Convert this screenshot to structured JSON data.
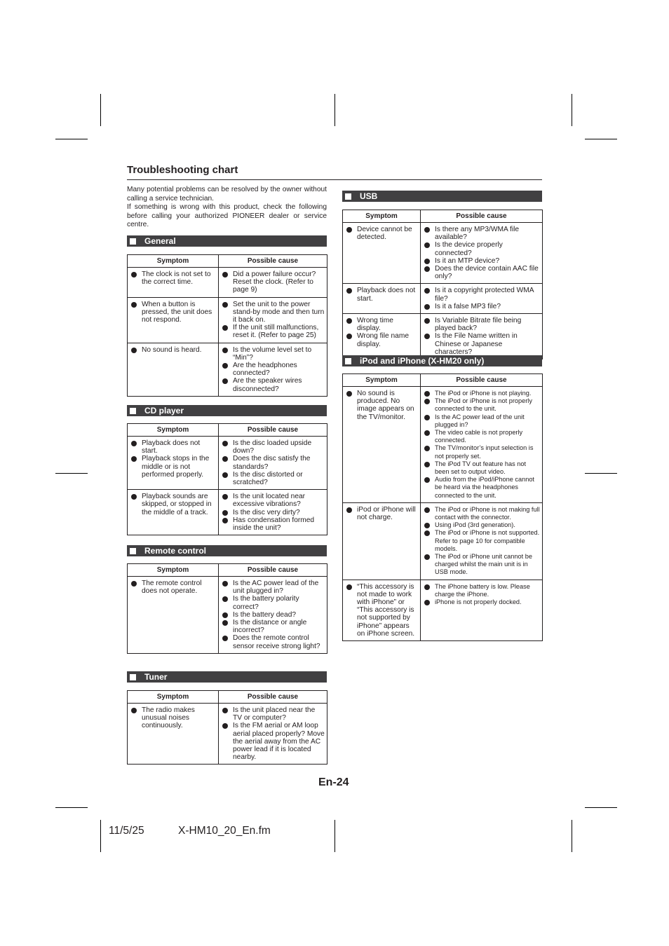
{
  "page": {
    "title": "Troubleshooting chart",
    "intro": [
      "Many potential problems can be resolved by the owner without calling a service technician.",
      "If something is wrong with this product, check the following before calling your authorized PIONEER dealer or service centre."
    ],
    "page_number": "En-24",
    "footer": {
      "date": "11/5/25",
      "filename": "X-HM10_20_En.fm"
    }
  },
  "columns": {
    "symptom": "Symptom",
    "cause": "Possible cause"
  },
  "sections": {
    "general": {
      "title": "General",
      "rows": [
        {
          "symptoms": [
            "The clock is not set to the correct time."
          ],
          "causes": [
            "Did a power failure occur? Reset the clock. (Refer to page 9)"
          ]
        },
        {
          "symptoms": [
            "When a button is pressed, the unit does not respond."
          ],
          "causes": [
            "Set the unit to the power stand-by mode and then turn it back on.",
            "If the unit still malfunctions, reset it. (Refer to page 25)"
          ]
        },
        {
          "symptoms": [
            "No sound is heard."
          ],
          "causes": [
            "Is the volume level set to “Min”?",
            "Are the headphones connected?",
            "Are the speaker wires disconnected?"
          ]
        }
      ]
    },
    "cd_player": {
      "title": "CD player",
      "rows": [
        {
          "symptoms": [
            "Playback does not start.",
            "Playback stops in the middle or is not performed properly."
          ],
          "causes": [
            "Is the disc loaded upside down?",
            "Does the disc satisfy the standards?",
            "Is the disc distorted or scratched?"
          ]
        },
        {
          "symptoms": [
            "Playback sounds are skipped, or stopped in the middle of a track."
          ],
          "causes": [
            "Is the unit located near excessive vibrations?",
            "Is the disc very dirty?",
            "Has condensation formed inside the unit?"
          ]
        }
      ]
    },
    "remote_control": {
      "title": "Remote control",
      "rows": [
        {
          "symptoms": [
            "The remote control does not operate."
          ],
          "causes": [
            "Is the AC power lead of the unit plugged in?",
            "Is the battery polarity correct?",
            "Is the battery dead?",
            "Is the distance or angle incorrect?",
            "Does the remote control sensor receive strong light?"
          ]
        }
      ]
    },
    "tuner": {
      "title": "Tuner",
      "rows": [
        {
          "symptoms": [
            "The radio makes unusual noises continuously."
          ],
          "causes": [
            "Is the unit placed near the TV or computer?",
            "Is the FM aerial or AM loop aerial placed properly? Move the aerial away from the AC power lead if it is located nearby."
          ]
        }
      ]
    },
    "usb": {
      "title": "USB",
      "rows": [
        {
          "symptoms": [
            "Device cannot be detected."
          ],
          "causes": [
            "Is there any MP3/WMA file available?",
            "Is the device properly connected?",
            "Is it an MTP device?",
            "Does the device contain AAC file only?"
          ]
        },
        {
          "symptoms": [
            "Playback does not start."
          ],
          "causes": [
            "Is it a copyright protected WMA file?",
            "Is it a false MP3 file?"
          ]
        },
        {
          "symptoms": [
            "Wrong time display.",
            "Wrong file name display."
          ],
          "causes": [
            "Is Variable Bitrate file being played back?",
            "Is the File Name written in Chinese or Japanese characters?"
          ]
        }
      ]
    },
    "ipod": {
      "title": "iPod and iPhone (X-HM20 only)",
      "rows": [
        {
          "symptoms": [
            "No sound is produced. No image appears on the TV/monitor."
          ],
          "causes": [
            "The iPod or iPhone is not playing.",
            "The iPod or iPhone is not properly connected to the unit.",
            "Is the AC power lead of the unit plugged in?",
            "The video cable is not properly connected.",
            "The TV/monitor’s input selection is not properly set.",
            "The iPod TV out feature has not been set to output video.",
            "Audio from the iPod/iPhone cannot be heard via the headphones connected to the unit."
          ]
        },
        {
          "symptoms": [
            "iPod or iPhone will not charge."
          ],
          "causes": [
            "The iPod or iPhone is not making full contact with the connector.",
            "Using iPod (3rd generation).",
            "The iPod or iPhone is not supported. Refer to page 10 for compatible models.",
            "The iPod or iPhone unit cannot be charged whilst the main unit is in USB mode."
          ]
        },
        {
          "symptoms": [
            "“This accessory is not made to work with iPhone” or “This accessory is not supported by iPhone” appears on iPhone screen."
          ],
          "causes": [
            "The iPhone battery is low. Please charge the iPhone.",
            "iPhone is not properly docked."
          ]
        }
      ]
    }
  }
}
